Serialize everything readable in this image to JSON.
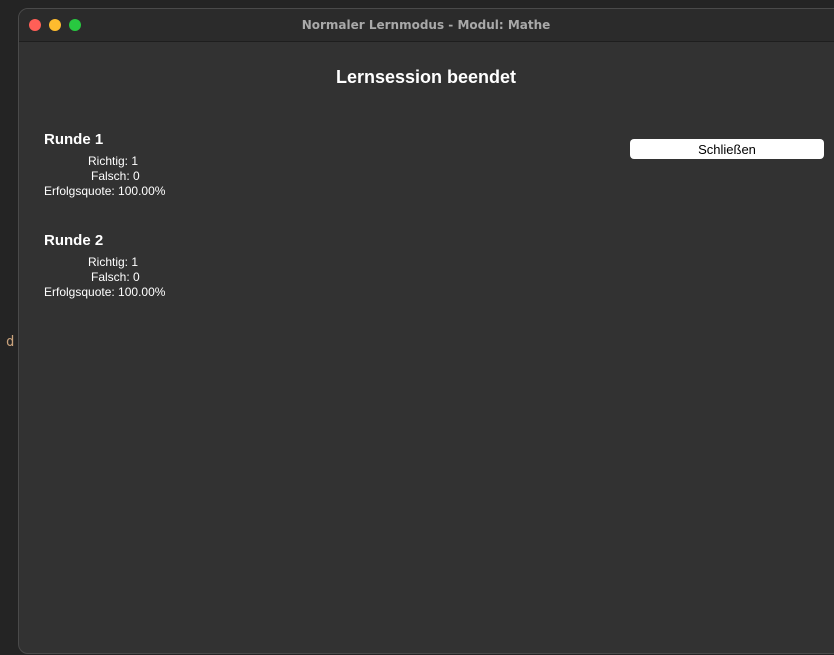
{
  "window": {
    "title": "Normaler Lernmodus - Modul: Mathe"
  },
  "session": {
    "title": "Lernsession beendet"
  },
  "rounds": [
    {
      "heading": "Runde 1",
      "correct": "Richtig: 1",
      "wrong": "Falsch: 0",
      "rate": "Erfolgsquote: 100.00%"
    },
    {
      "heading": "Runde 2",
      "correct": "Richtig: 1",
      "wrong": "Falsch: 0",
      "rate": "Erfolgsquote: 100.00%"
    }
  ],
  "actions": {
    "close_label": "Schließen"
  },
  "backdrop": {
    "glyph": "d"
  },
  "colors": {
    "window_bg": "#323232",
    "titlebar_bg": "#2b2b2b",
    "traffic_close": "#ff5f57",
    "traffic_minimize": "#febc2e",
    "traffic_maximize": "#28c840"
  }
}
